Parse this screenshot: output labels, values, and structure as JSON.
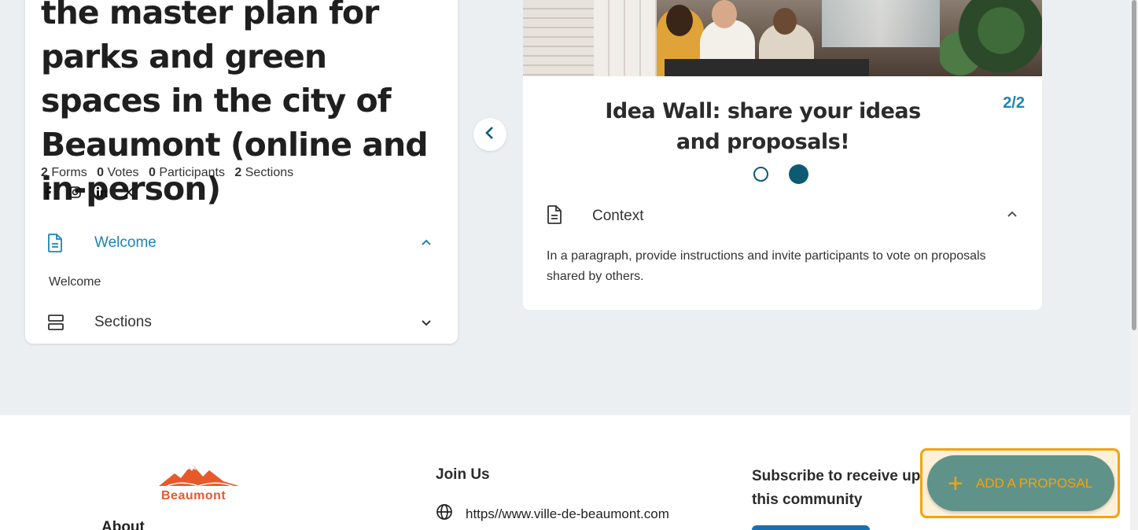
{
  "left_card": {
    "title": "the master plan for parks and green spaces in the city of Beaumont (online and in-person)",
    "stats": {
      "forms_count": "2",
      "forms_label": "Forms",
      "votes_count": "0",
      "votes_label": "Votes",
      "participants_count": "0",
      "participants_label": "Participants",
      "sections_count": "2",
      "sections_label": "Sections"
    },
    "socials": [
      "facebook-icon",
      "instagram-icon",
      "linkedin-icon",
      "x-icon"
    ],
    "accordion": [
      {
        "label": "Welcome",
        "icon": "document-icon",
        "expanded": true,
        "body": "Welcome"
      },
      {
        "label": "Sections",
        "icon": "sections-icon",
        "expanded": false
      }
    ],
    "accent_color": "#1a85b8"
  },
  "carousel": {
    "card_title": "Idea Wall: share your ideas and proposals!",
    "pager": "2/2",
    "context_label": "Context",
    "context_body": "In a paragraph, provide instructions and invite participants to vote on proposals shared by others.",
    "dot_color": "#0d5a74"
  },
  "footer": {
    "logo_text": "Beaumont",
    "about_label": "About",
    "join_label": "Join Us",
    "website": "https//www.ville-de-beaumont.com",
    "subscribe_text": "Subscribe to receive up this community"
  },
  "fab": {
    "label": "ADD A PROPOSAL",
    "bg_color": "#5f9389",
    "text_color": "#f5a20a"
  }
}
